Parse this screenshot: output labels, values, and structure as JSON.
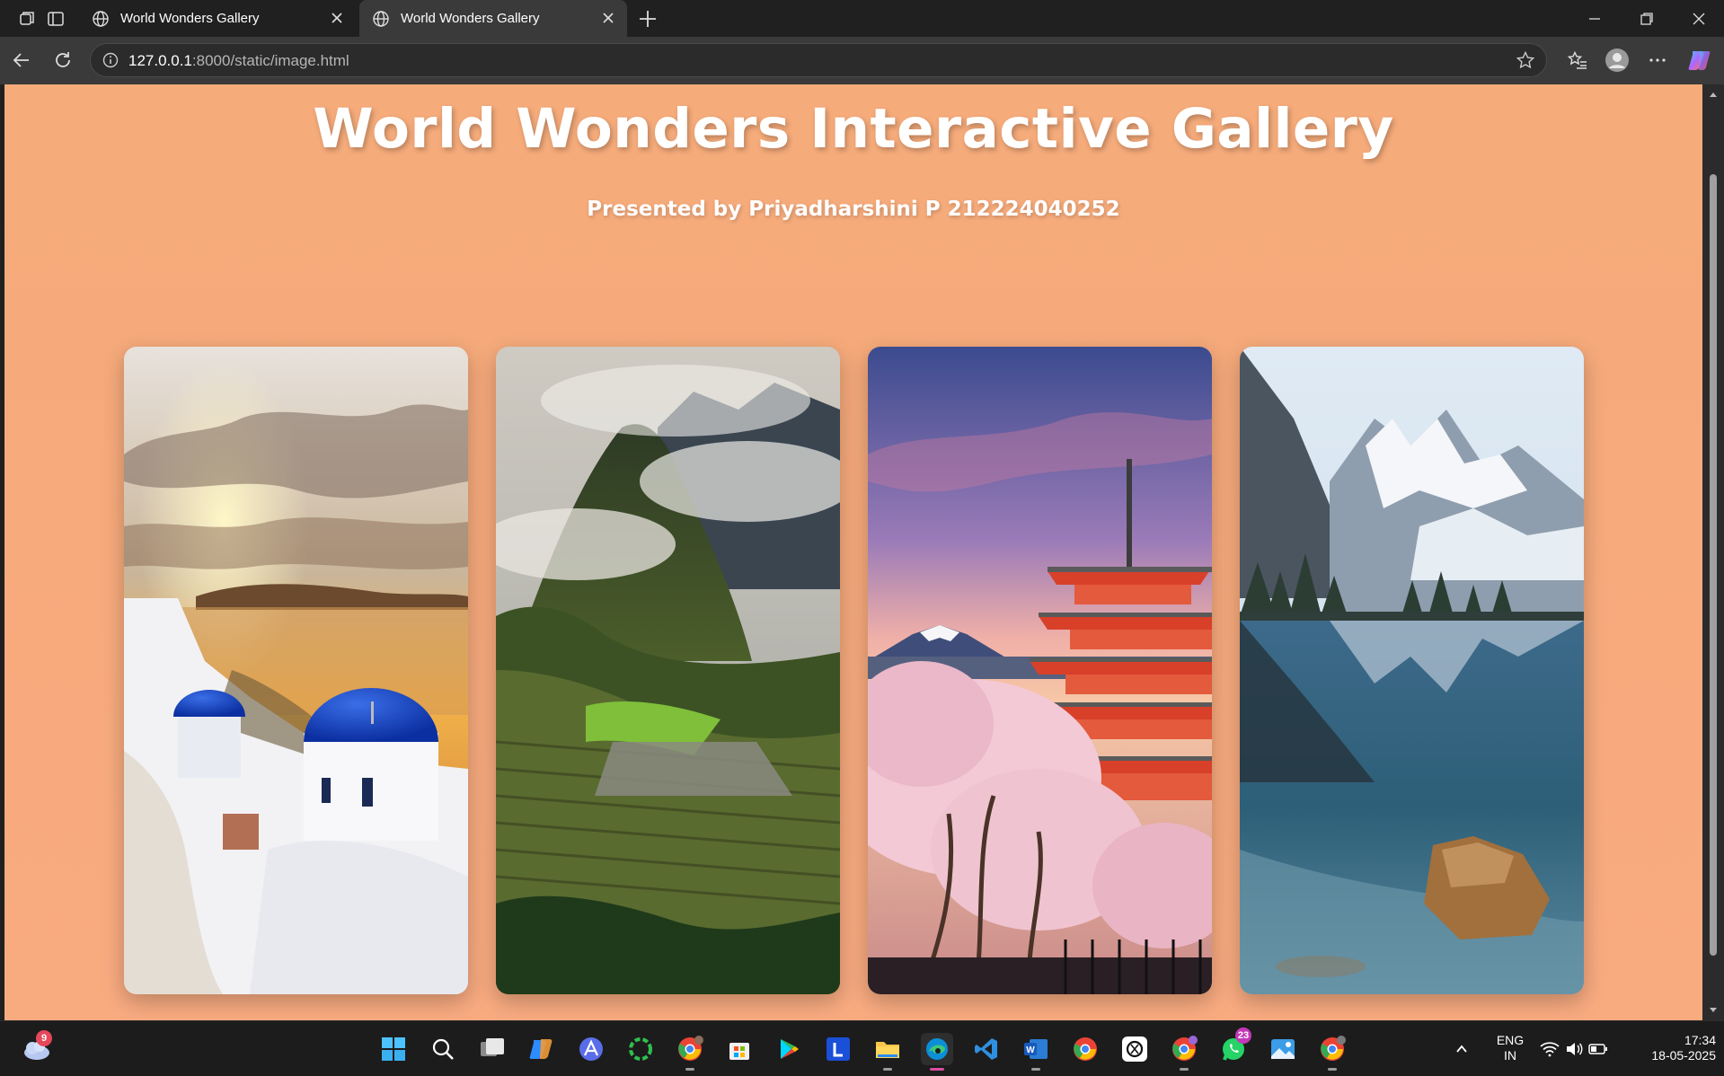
{
  "browser": {
    "tabs": [
      {
        "title": "World Wonders Gallery",
        "active": false
      },
      {
        "title": "World Wonders Gallery",
        "active": true
      }
    ],
    "url_host": "127.0.0.1",
    "url_path": ":8000/static/image.html"
  },
  "page": {
    "title": "World Wonders Interactive Gallery",
    "subtitle": "Presented by Priyadharshini P 212224040252",
    "background_color": "#f7aa7c",
    "cards": [
      {
        "scene": "santorini-blue-domes-sunset"
      },
      {
        "scene": "machu-picchu-mountain-ruins"
      },
      {
        "scene": "fuji-pagoda-cherry-blossoms"
      },
      {
        "scene": "snowy-mountain-lake-reflection"
      }
    ]
  },
  "taskbar": {
    "weather_badge": "9",
    "apps": [
      {
        "icon": "windows-start-icon"
      },
      {
        "icon": "search-icon"
      },
      {
        "icon": "task-view-icon"
      },
      {
        "icon": "copilot-icon"
      },
      {
        "icon": "app-a-icon"
      },
      {
        "icon": "circle-app-icon"
      },
      {
        "icon": "chrome-profile-p-icon"
      },
      {
        "icon": "microsoft-store-icon"
      },
      {
        "icon": "google-play-icon"
      },
      {
        "icon": "l-app-icon"
      },
      {
        "icon": "file-explorer-icon"
      },
      {
        "icon": "edge-icon"
      },
      {
        "icon": "vscode-icon"
      },
      {
        "icon": "word-icon"
      },
      {
        "icon": "chrome-icon"
      },
      {
        "icon": "chatgpt-icon"
      },
      {
        "icon": "chrome-profile-icon"
      },
      {
        "icon": "whatsapp-icon"
      },
      {
        "icon": "photos-icon"
      },
      {
        "icon": "chrome-profile-2-icon"
      }
    ],
    "whatsapp_badge": "23",
    "language_line1": "ENG",
    "language_line2": "IN",
    "time": "17:34",
    "date": "18-05-2025"
  }
}
